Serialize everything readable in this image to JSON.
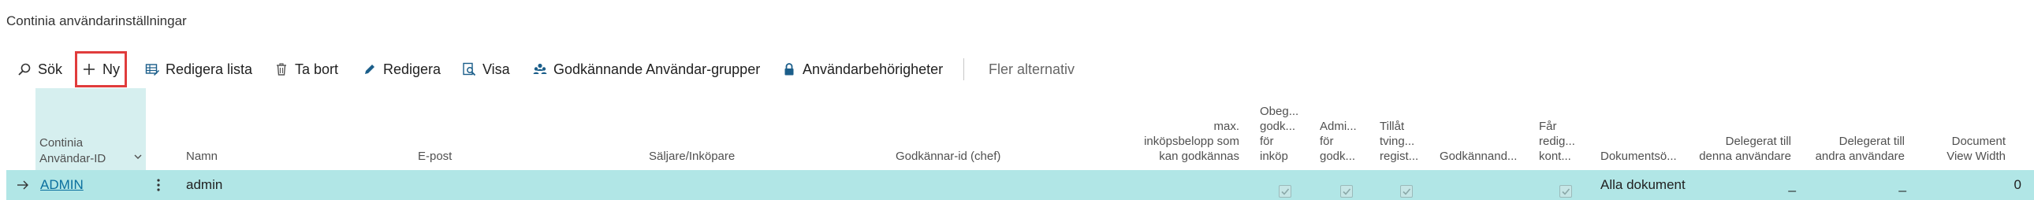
{
  "page": {
    "title": "Continia användarinställningar"
  },
  "toolbar": {
    "search": "Sök",
    "new": "Ny",
    "edit_list": "Redigera lista",
    "delete": "Ta bort",
    "edit": "Redigera",
    "view": "Visa",
    "approval_groups": "Godkännande Användar-grupper",
    "user_permissions": "Användarbehörigheter",
    "more": "Fler alternativ"
  },
  "columns": {
    "user_id": [
      "Continia",
      "Användar-ID"
    ],
    "name": "Namn",
    "email": "E-post",
    "salesperson": "Säljare/Inköpare",
    "approver_id": "Godkännar-id (chef)",
    "max_amount": [
      "max.",
      "inköpsbelopp som",
      "kan godkännas"
    ],
    "unlimited": [
      "Obeg...",
      "godk...",
      "för",
      "inköp"
    ],
    "admin": [
      "Admi...",
      "för",
      "godk..."
    ],
    "allow_forced": [
      "Tillåt",
      "tving...",
      "regist..."
    ],
    "approval": "Godkännand...",
    "may_edit": [
      "Får",
      "redig...",
      "kont..."
    ],
    "document": "Dokumentsö...",
    "delegated_to": [
      "Delegerat till",
      "denna användare"
    ],
    "delegated_other": [
      "Delegerat till",
      "andra användare"
    ],
    "view_width": [
      "Document",
      "View Width"
    ]
  },
  "rows": [
    {
      "user_id": "ADMIN",
      "name": "admin",
      "document": "Alla dokument",
      "delegated_to": "_",
      "delegated_other": "_",
      "view_width": "0",
      "unlimited": true,
      "admin": true,
      "allow_forced": true,
      "may_edit": true
    }
  ],
  "icons": {
    "search": "search-icon",
    "new": "plus-icon",
    "edit_list": "edit-list-icon",
    "delete": "trash-icon",
    "edit": "pencil-icon",
    "view": "view-icon",
    "groups": "people-icon",
    "permissions": "lock-icon",
    "chevron": "chevron-down-icon",
    "row_arrow": "arrow-right-icon",
    "row_menu": "more-vertical-icon"
  },
  "colors": {
    "accent": "#0a6f9e",
    "selected_row": "#b1e6e6",
    "selected_column": "#d6efef",
    "highlight_box": "#e03c3c"
  }
}
